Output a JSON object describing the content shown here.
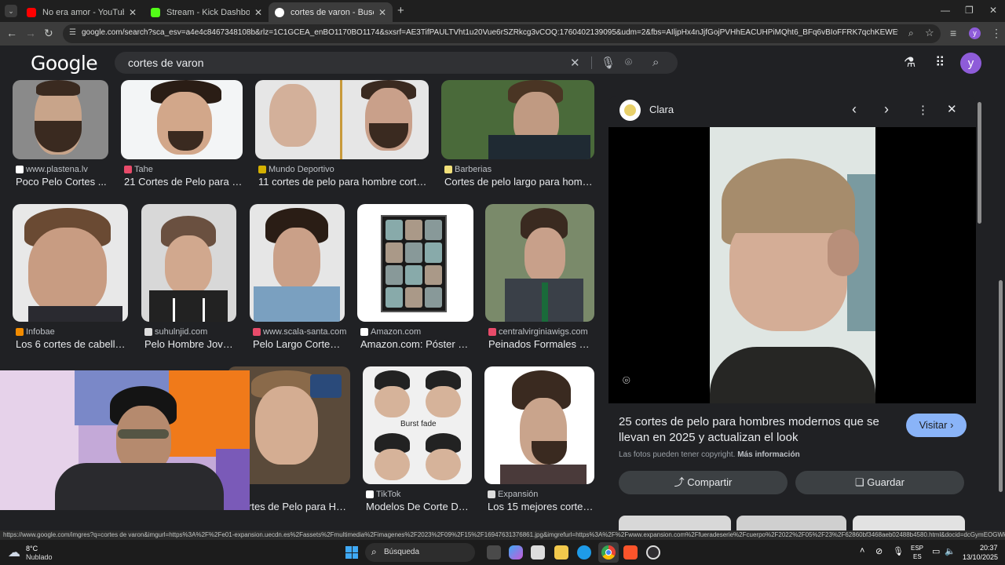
{
  "browser": {
    "tabs": [
      {
        "title": "No era amor - YouTube",
        "color": "#ff0000"
      },
      {
        "title": "Stream - Kick Dashboard",
        "color": "#53fc18"
      },
      {
        "title": "cortes de varon - Buscar con Google",
        "color": "#ffffff"
      }
    ],
    "new_tab": "+",
    "url": "google.com/search?sca_esv=a4e4c8467348108b&rlz=1C1GCEA_enBO1170BO1174&sxsrf=AE3TifPAULTVht1u20Vue6rSZRkcg3vCOQ:1760402139095&udm=2&fbs=AIljpHx4nJjfGojPVHhEACUHPiMQht6_BFq6vBIoFFRK7qchKEWEvuc0Hbw31oEI7c8o3y4M...",
    "profile_initial": "y"
  },
  "google": {
    "logo": "Google",
    "query": "cortes de varon",
    "profile_initial": "y"
  },
  "results": [
    {
      "source": "www.plastena.lv",
      "caption": "Poco Pelo Cortes ...",
      "favcolor": "#ffffff"
    },
    {
      "source": "Tahe",
      "caption": "21 Cortes de Pelo para H...",
      "favcolor": "#e84b6a"
    },
    {
      "source": "Mundo Deportivo",
      "caption": "11 cortes de pelo para hombre corto ...",
      "favcolor": "#d4b000"
    },
    {
      "source": "Barberias",
      "caption": "Cortes de pelo largo para hombr...",
      "favcolor": "#f2e07a"
    },
    {
      "source": "Infobae",
      "caption": "Los 6 cortes de cabello ...",
      "favcolor": "#f28c00"
    },
    {
      "source": "suhulnjid.com",
      "caption": "Pelo Hombre Jove...",
      "favcolor": "#dddddd"
    },
    {
      "source": "www.scala-santa.com",
      "caption": "Pelo Largo Cortes ...",
      "favcolor": "#e84b6a"
    },
    {
      "source": "Amazon.com",
      "caption": "Amazon.com: Póster de...",
      "favcolor": "#ffffff"
    },
    {
      "source": "centralvirginiawigs.com",
      "caption": "Peinados Formales C...",
      "favcolor": "#e84b6a"
    },
    {
      "source": "",
      "caption": "rtes de Pelo para Ho...",
      "favcolor": "#ffffff"
    },
    {
      "source": "TikTok",
      "caption": "Modelos De Corte De ...",
      "favcolor": "#ffffff"
    },
    {
      "source": "Expansión",
      "caption": "Los 15 mejores cortes...",
      "favcolor": "#dddddd"
    }
  ],
  "burst_fade_label": "Burst fade",
  "preview": {
    "source": "Clara",
    "title": "25 cortes de pelo para hombres modernos que se llevan en 2025 y actualizan el look",
    "visit": "Visitar",
    "copyright": "Las fotos pueden tener copyright.",
    "more_info": "Más información",
    "share": "Compartir",
    "save": "Guardar"
  },
  "status_url": "https://www.google.com/imgres?q=cortes de varon&imgurl=https%3A%2F%2Fe01-expansion.uecdn.es%2Fassets%2Fmultimedia%2Fimagenes%2F2023%2F09%2F15%2F16947631376861.jpg&imgrefurl=https%3A%2F%2Fwww.expansion.com%2Ffueradeserie%2Fcuerpo%2F2022%2F05%2F23%2F62860bf3468aeb02488b4580.html&docid=dcGymEOGWk...",
  "taskbar": {
    "temp": "8°C",
    "weather": "Nublado",
    "search": "Búsqueda",
    "lang1": "ESP",
    "lang2": "ES",
    "time": "20:37",
    "date": "13/10/2025"
  }
}
